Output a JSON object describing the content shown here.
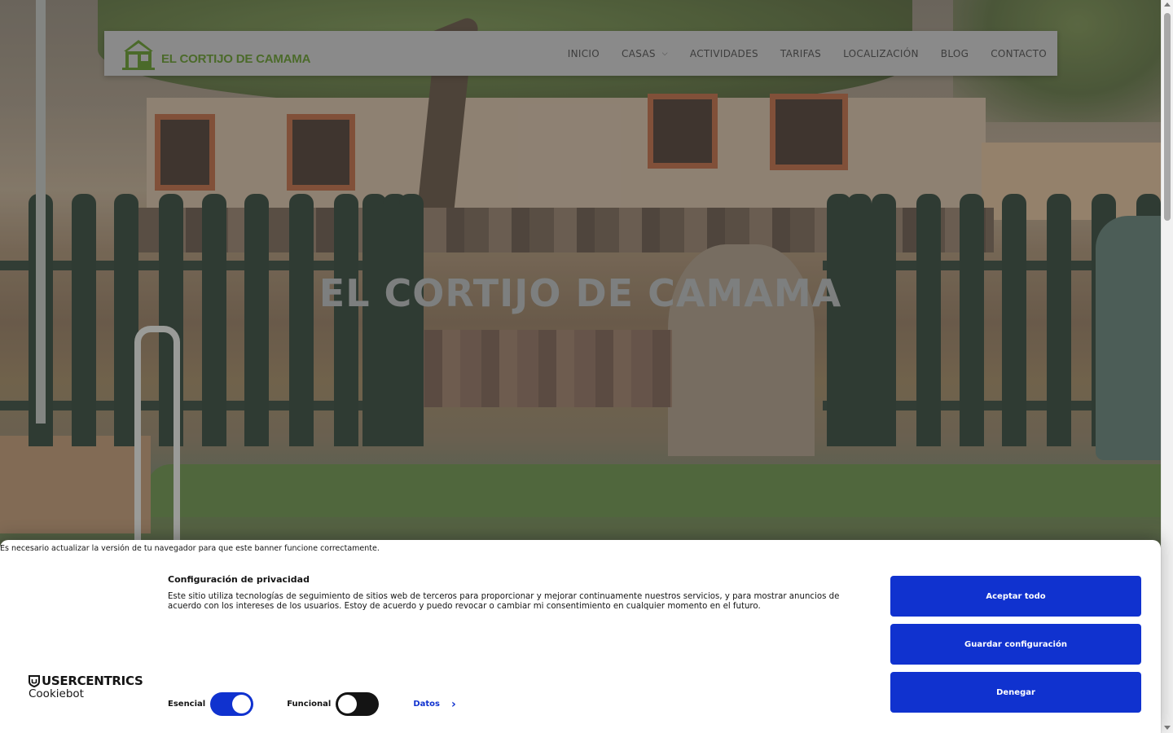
{
  "header": {
    "logo_text": "EL CORTIJO DE CAMAMA",
    "nav": [
      {
        "label": "INICIO"
      },
      {
        "label": "CASAS",
        "has_dropdown": true
      },
      {
        "label": "ACTIVIDADES"
      },
      {
        "label": "TARIFAS"
      },
      {
        "label": "LOCALIZACIÓN"
      },
      {
        "label": "BLOG"
      },
      {
        "label": "CONTACTO"
      }
    ]
  },
  "hero": {
    "title": "EL CORTIJO DE CAMAMA"
  },
  "cookie_banner": {
    "browser_note": "Es necesario actualizar la versión de tu navegador para que este banner funcione correctamente.",
    "brand": "USERCENTRICS",
    "brand_sub": "Cookiebot",
    "title": "Configuración de privacidad",
    "text": "Este sitio utiliza tecnologías de seguimiento de sitios web de terceros para proporcionar y mejorar continuamente nuestros servicios, y para mostrar anuncios de acuerdo con los intereses de los usuarios. Estoy de acuerdo y puedo revocar o cambiar mi consentimiento en cualquier momento en el futuro.",
    "toggles": [
      {
        "label": "Esencial",
        "on": true
      },
      {
        "label": "Funcional",
        "on": false
      }
    ],
    "details_link": "Datos",
    "buttons": {
      "accept_all": "Aceptar todo",
      "save_settings": "Guardar configuración",
      "deny": "Denegar"
    }
  },
  "colors": {
    "primary_button": "#1032cf",
    "logo_green": "#4b6a2a",
    "toggle_off": "#141414"
  }
}
